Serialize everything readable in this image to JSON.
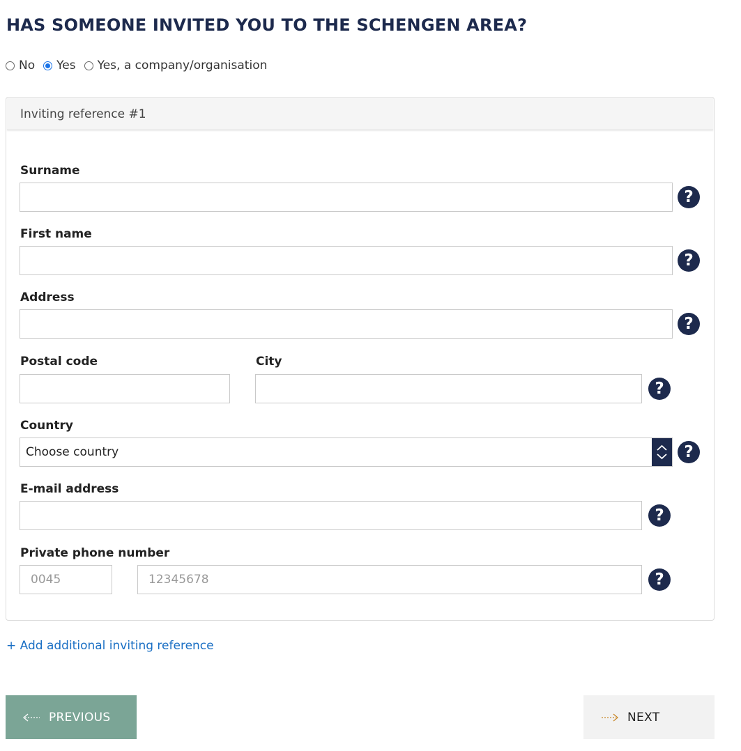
{
  "page": {
    "title": "HAS SOMEONE INVITED YOU TO THE SCHENGEN AREA?"
  },
  "invitation_options": [
    {
      "label": "No",
      "checked": false
    },
    {
      "label": "Yes",
      "checked": true
    },
    {
      "label": "Yes, a company/organisation",
      "checked": false
    }
  ],
  "panel": {
    "header": "Inviting reference #1",
    "fields": {
      "surname": {
        "label": "Surname",
        "value": ""
      },
      "first_name": {
        "label": "First name",
        "value": ""
      },
      "address": {
        "label": "Address",
        "value": ""
      },
      "postal_code": {
        "label": "Postal code",
        "value": ""
      },
      "city": {
        "label": "City",
        "value": ""
      },
      "country": {
        "label": "Country",
        "selected": "Choose country"
      },
      "email": {
        "label": "E-mail address",
        "value": ""
      },
      "phone": {
        "label": "Private phone number",
        "prefix_placeholder": "0045",
        "number_placeholder": "12345678"
      }
    },
    "help_glyph": "?"
  },
  "add_link": "+ Add additional inviting reference",
  "nav": {
    "previous": "PREVIOUS",
    "next": "NEXT"
  },
  "colors": {
    "navy": "#1d2a4d",
    "link": "#1a6fc4",
    "previous_bg": "#7ba596",
    "next_bg": "#f2f2f2",
    "next_arrow": "#c9892b",
    "radio_accent": "#1a73e8"
  }
}
